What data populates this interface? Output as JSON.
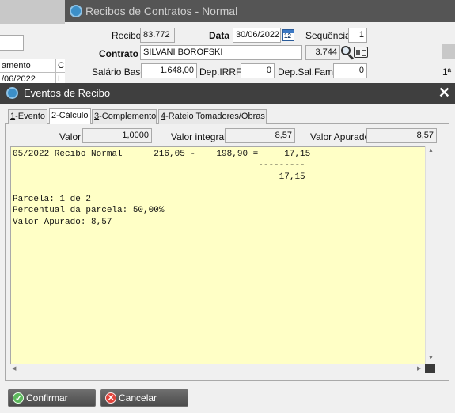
{
  "background_left": {
    "header_col1": "amento",
    "header_col2": "C",
    "row_col1": "/06/2022",
    "row_col2": "L"
  },
  "recibos_window": {
    "title": "Recibos de Contratos - Normal",
    "recibo_label": "Recibo",
    "recibo_value": "83.772",
    "data_label": "Data",
    "data_value": "30/06/2022",
    "sequencia_label": "Sequência",
    "sequencia_value": "1",
    "contrato_label": "Contrato",
    "contrato_value": "SILVANI BOROFSKI",
    "contrato_code": "3.744",
    "salario_label": "Salário Base",
    "salario_value": "1.648,00",
    "depirrf_label": "Dep.IRRF",
    "depirrf_value": "0",
    "depsalfam_label": "Dep.Sal.Fam.",
    "depsalfam_value": "0",
    "right_label": "1ª"
  },
  "dialog": {
    "title": "Eventos de Recibo",
    "tabs": [
      {
        "key": "1",
        "label": "-Evento"
      },
      {
        "key": "2",
        "label": "-Cálculo"
      },
      {
        "key": "3",
        "label": "-Complemento"
      },
      {
        "key": "4",
        "label": "-Rateio Tomadores/Obras"
      }
    ],
    "valor_label": "Valor",
    "valor_value": "1,0000",
    "valor_integral_label": "Valor integral",
    "valor_integral_value": "8,57",
    "valor_apurado_label": "Valor Apurado",
    "valor_apurado_value": "8,57",
    "memo_text": "05/2022 Recibo Normal      216,05 -    198,90 =     17,15\n                                               ---------\n                                                   17,15\n\nParcela: 1 de 2\nPercentual da parcela: 50,00%\nValor Apurado: 8,57",
    "confirm_label": "Confirmar",
    "cancel_label": "Cancelar"
  }
}
